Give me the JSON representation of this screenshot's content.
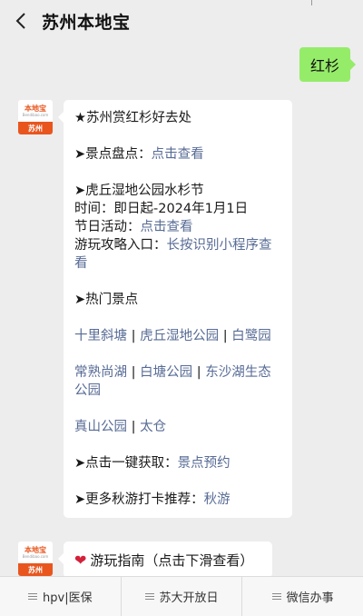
{
  "nav": {
    "title": "苏州本地宝"
  },
  "user_msg": "红杉",
  "avatar": {
    "logo": "本地宝",
    "logo_sub": "Bendibao.com",
    "city": "苏州"
  },
  "article": {
    "heading": "★苏州赏红杉好去处",
    "spots_prefix": "➤景点盘点：",
    "spots_link": "点击查看",
    "festival_title": "➤虎丘湿地公园水杉节",
    "time_line": "时间：即日起-2024年1月1日",
    "activity_prefix": "节日活动：",
    "activity_link": "点击查看",
    "guide_prefix": "游玩攻略入口：",
    "guide_link_1": "长按识别小程序查",
    "guide_link_2": "看",
    "hot_title": "➤热门景点",
    "row1": [
      "十里斜塘",
      "虎丘湿地公园",
      "白鹭园"
    ],
    "row2a": [
      "常熟尚湖",
      "白塘公园",
      "东沙湖生态"
    ],
    "row2b": "公园",
    "row3": [
      "真山公园",
      "太仓"
    ],
    "sep": "|",
    "reserve_prefix": "➤点击一键获取：",
    "reserve_link": "景点预约",
    "more_prefix": "➤更多秋游打卡推荐：",
    "more_link": "秋游"
  },
  "second_msg": "游玩指南（点击下滑查看）",
  "bottom_tabs": [
    "hpv|医保",
    "苏大开放日",
    "微信办事"
  ]
}
